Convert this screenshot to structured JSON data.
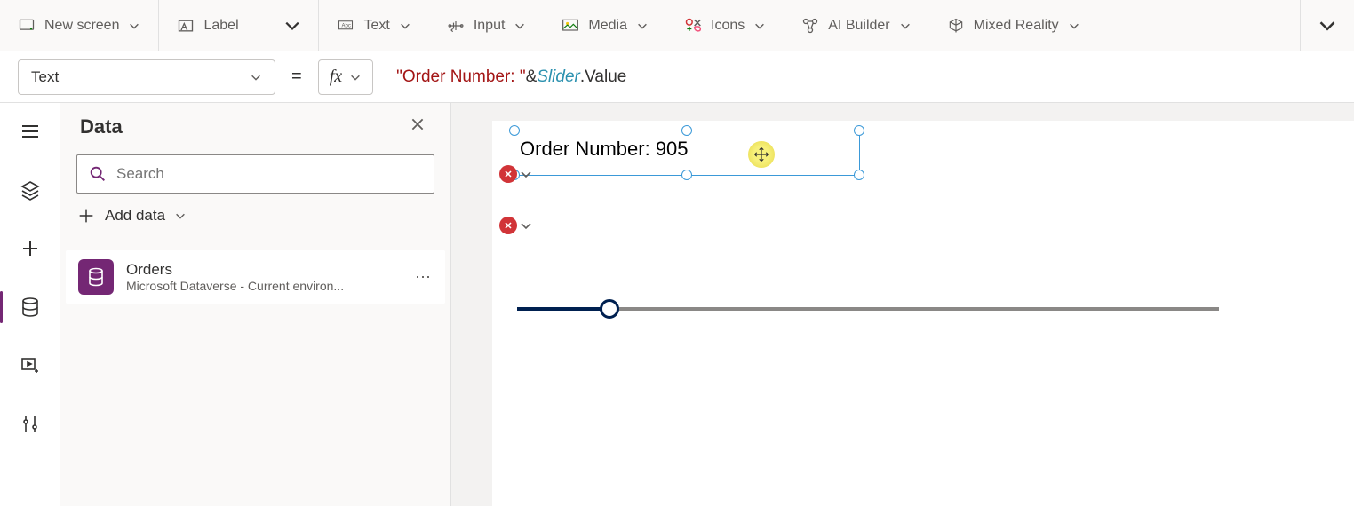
{
  "ribbon": {
    "new_screen": "New screen",
    "label": "Label",
    "text": "Text",
    "input": "Input",
    "media": "Media",
    "icons": "Icons",
    "ai_builder": "AI Builder",
    "mixed_reality": "Mixed Reality"
  },
  "formula": {
    "property": "Text",
    "fx": "fx",
    "equals": "=",
    "tok_string": "\"Order Number: \"",
    "tok_amp": " & ",
    "tok_var": "Slider",
    "tok_rest": ".Value"
  },
  "pane": {
    "title": "Data",
    "search_placeholder": "Search",
    "add_data": "Add data"
  },
  "datasource": {
    "name": "Orders",
    "subtitle": "Microsoft Dataverse - Current environ..."
  },
  "canvas": {
    "label_value": "Order Number: 905"
  }
}
